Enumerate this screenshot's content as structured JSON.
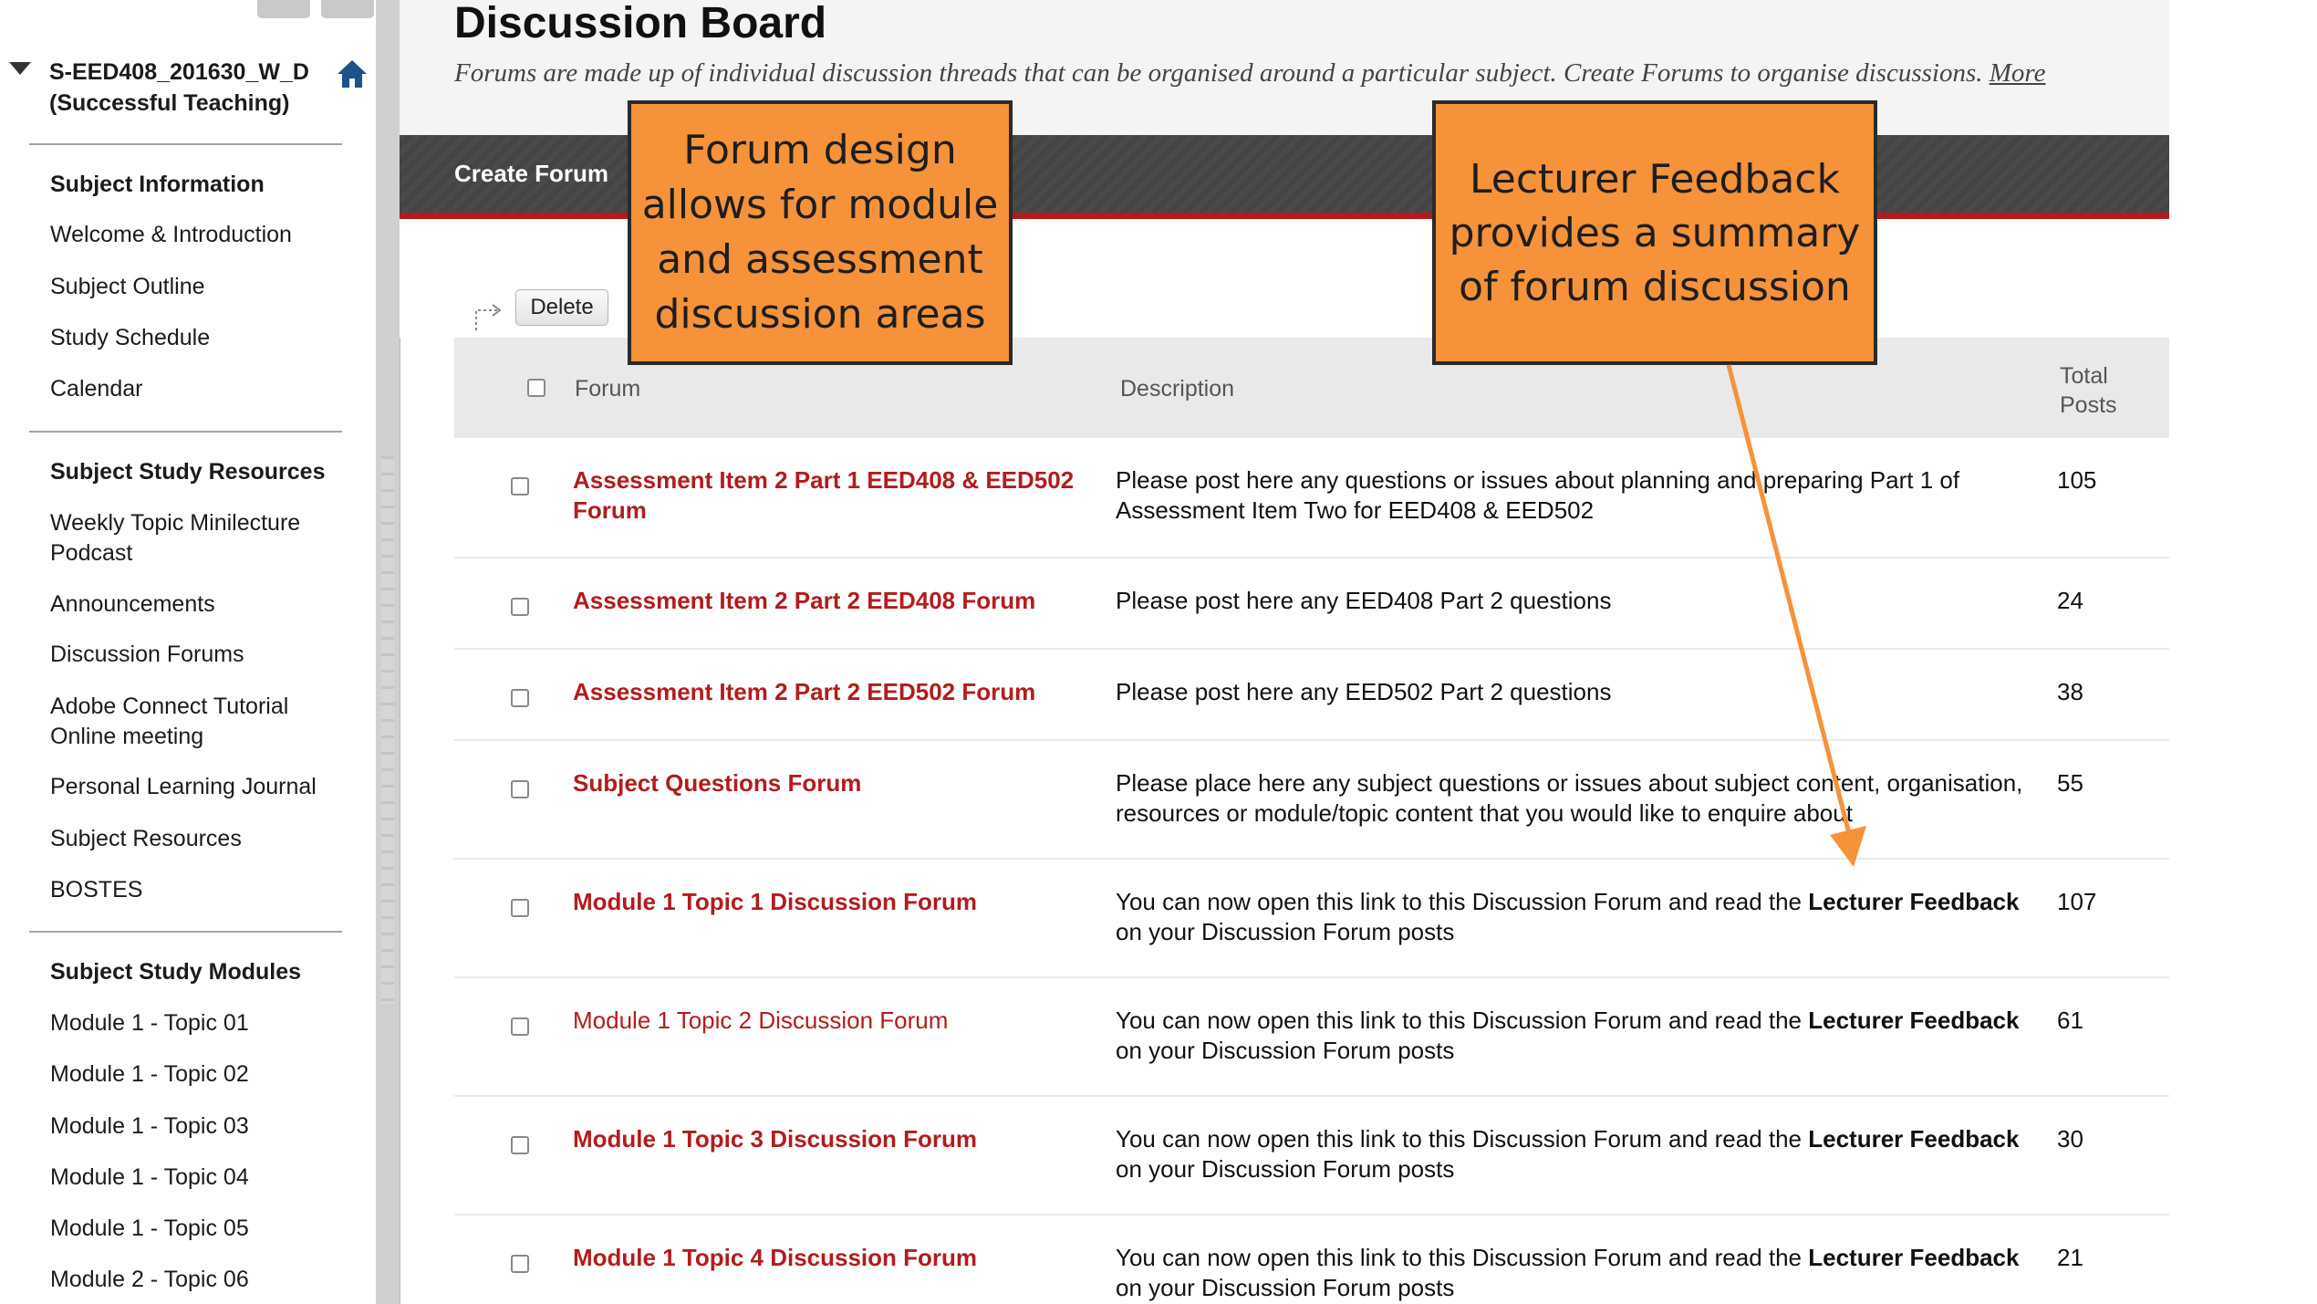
{
  "course": {
    "title": "S-EED408_201630_W_D (Successful Teaching)"
  },
  "sidebar": {
    "sections": [
      {
        "heading": "Subject Information",
        "items": [
          "Welcome & Introduction",
          "Subject Outline",
          "Study Schedule",
          "Calendar"
        ]
      },
      {
        "heading": "Subject Study Resources",
        "items": [
          "Weekly Topic Minilecture Podcast",
          "Announcements",
          "Discussion Forums",
          "Adobe Connect Tutorial Online meeting",
          "Personal Learning Journal",
          "Subject Resources",
          "BOSTES"
        ]
      },
      {
        "heading": "Subject Study Modules",
        "items": [
          "Module 1 - Topic 01",
          "Module 1 - Topic 02",
          "Module 1 - Topic 03",
          "Module 1 - Topic 04",
          "Module 1 - Topic 05",
          "Module 2 - Topic 06"
        ]
      }
    ]
  },
  "page": {
    "title": "Discussion Board",
    "description": "Forums are made up of individual discussion threads that can be organised around a particular subject. Create Forums to organise discussions.",
    "more_label": "More"
  },
  "toolbar": {
    "create_forum_label": "Create Forum",
    "delete_label": "Delete"
  },
  "table": {
    "headers": {
      "forum": "Forum",
      "description": "Description",
      "total_posts": "Total Posts"
    },
    "rows": [
      {
        "forum": "Assessment Item 2 Part 1 EED408 & EED502 Forum",
        "description": "Please post here any questions or issues about planning and preparing Part 1 of Assessment Item Two for EED408 & EED502",
        "posts": "105"
      },
      {
        "forum": "Assessment Item 2 Part 2 EED408 Forum",
        "description": "Please post here any EED408 Part 2 questions",
        "posts": "24"
      },
      {
        "forum": "Assessment Item 2 Part 2 EED502 Forum",
        "description": "Please post here any EED502 Part 2 questions",
        "posts": "38"
      },
      {
        "forum": "Subject Questions Forum",
        "description": "Please place here any subject questions or issues about subject content, organisation, resources or module/topic content that you would like to enquire about",
        "posts": "55"
      },
      {
        "forum": "Module 1 Topic 1 Discussion Forum",
        "description_pre": "You can now open this link to this Discussion Forum and read the ",
        "description_bold": "Lecturer Feedback",
        "description_post": " on your Discussion Forum posts",
        "posts": "107"
      },
      {
        "forum": "Module 1 Topic 2 Discussion Forum",
        "description_pre": "You can now open this link to this Discussion Forum and read the ",
        "description_bold": "Lecturer Feedback",
        "description_post": " on your Discussion Forum posts",
        "posts": "61"
      },
      {
        "forum": "Module 1 Topic 3 Discussion Forum",
        "description_pre": "You can now open this link to this Discussion Forum and read the ",
        "description_bold": "Lecturer Feedback",
        "description_post": " on your Discussion Forum posts",
        "posts": "30"
      },
      {
        "forum": "Module 1 Topic 4 Discussion Forum",
        "description_pre": "You can now open this link to this Discussion Forum and read the ",
        "description_bold": "Lecturer Feedback",
        "description_post": " on your Discussion Forum posts",
        "posts": "21"
      }
    ]
  },
  "callouts": {
    "forum_design": "Forum design allows for module and assessment discussion areas",
    "lecturer_feedback": "Lecturer Feedback provides a summary of forum discussion"
  },
  "icons": {
    "home": "home-icon",
    "toggle": "triangle-down-icon",
    "delete_arrow": "dotted-arrow-icon"
  },
  "colors": {
    "forum_link": "#b31c1c",
    "action_bar": "#4a4a4a",
    "action_bar_accent": "#b51b1b",
    "callout": "#f5923a"
  }
}
